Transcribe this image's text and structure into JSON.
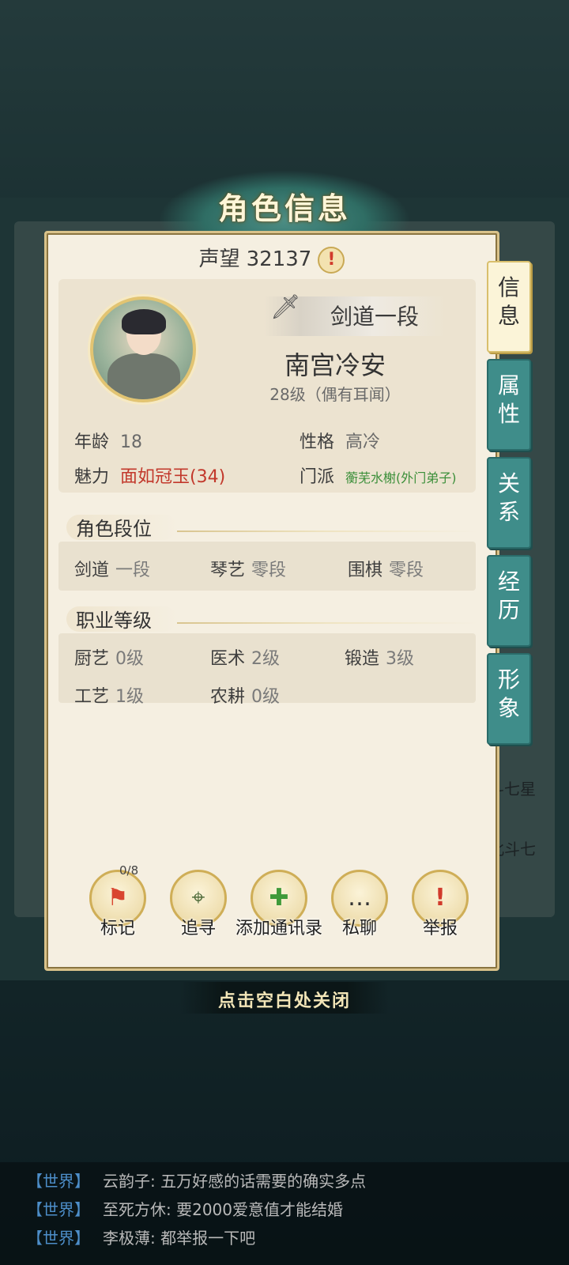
{
  "dialog": {
    "title": "角色信息",
    "fame_label": "声望",
    "fame_value": "32137",
    "fame_alert": "!"
  },
  "character": {
    "rank_badge": "剑道一段",
    "name": "南宫冷安",
    "level": "28级（偶有耳闻）",
    "age_label": "年龄",
    "age_value": "18",
    "personality_label": "性格",
    "personality_value": "高冷",
    "charm_label": "魅力",
    "charm_value": "面如冠玉(34)",
    "sect_label": "门派",
    "sect_value": "蘅芜水榭(外门弟子)"
  },
  "segments": {
    "title": "角色段位",
    "items": [
      {
        "label": "剑道",
        "value": "一段"
      },
      {
        "label": "琴艺",
        "value": "零段"
      },
      {
        "label": "围棋",
        "value": "零段"
      }
    ]
  },
  "jobs": {
    "title": "职业等级",
    "items": [
      {
        "label": "厨艺",
        "value": "0级"
      },
      {
        "label": "医术",
        "value": "2级"
      },
      {
        "label": "锻造",
        "value": "3级"
      },
      {
        "label": "工艺",
        "value": "1级"
      },
      {
        "label": "农耕",
        "value": "0级"
      }
    ]
  },
  "actions": {
    "mark_label": "标记",
    "mark_counter": "0/8",
    "trace_label": "追寻",
    "add_contact_label": "添加通讯录",
    "chat_label": "私聊",
    "report_label": "举报"
  },
  "tabs": [
    {
      "label": "信\n息",
      "active": true
    },
    {
      "label": "属\n性",
      "active": false
    },
    {
      "label": "关\n系",
      "active": false
    },
    {
      "label": "经\n历",
      "active": false
    },
    {
      "label": "形\n象",
      "active": false
    }
  ],
  "close_hint": "点击空白处关闭",
  "background": {
    "text_a": "斗七星",
    "text_b": "北斗七"
  },
  "chat": [
    {
      "channel": "【世界】",
      "text": "云韵子: 五万好感的话需要的确实多点"
    },
    {
      "channel": "【世界】",
      "text": "至死方休: 要2000爱意值才能结婚"
    },
    {
      "channel": "【世界】",
      "text": "李极薄: 都举报一下吧"
    }
  ]
}
